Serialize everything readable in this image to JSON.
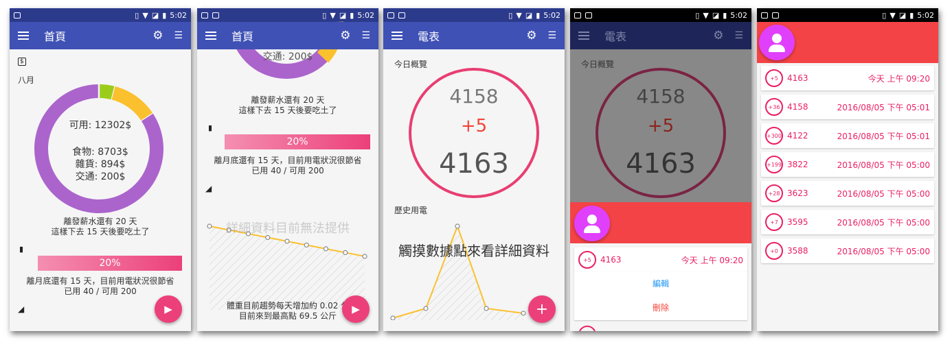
{
  "status": {
    "time": "5:02"
  },
  "colors": {
    "primary": "#3f51b5",
    "accent": "#ec407a",
    "pink": "#e91e63",
    "red": "#f44336"
  },
  "screen1": {
    "title": "首頁",
    "month": "八月",
    "available": "可用: 12302$",
    "cat_food": "食物:  8703$",
    "cat_grocery": "雜貨:    894$",
    "cat_transport": "交通:    200$",
    "payday_line1": "離發薪水還有 20 天",
    "payday_line2": "這樣下去 15 天後要吃土了",
    "progress": "20%",
    "progress_value": 0.2,
    "elec_line1": "離月底還有 15 天，目前用電狀況很節省",
    "elec_line2": "已用 40 / 可用 200"
  },
  "screen2": {
    "title": "首頁",
    "transport_partial": "交通:    200$",
    "payday_line1": "離發薪水還有 20 天",
    "payday_line2": "這樣下去 15 天後要吃土了",
    "progress": "20%",
    "elec_line1": "離月底還有 15 天，目前用電狀況很節省",
    "elec_line2": "已用 40 / 可用 200",
    "chart_overlay": "詳細資料目前無法提供",
    "weight_line1": "體重目前趨勢每天增加約 0.02 公",
    "weight_line2": "目前來到最高點 69.5 公斤"
  },
  "screen3": {
    "title": "電表",
    "overview": "今日概覽",
    "prev_reading": "4158",
    "delta": "+5",
    "current_reading": "4163",
    "history": "歷史用電",
    "touch_hint": "觸摸數據點來看詳細資料"
  },
  "screen4": {
    "title": "電表",
    "overview": "今日概覽",
    "prev_reading": "4158",
    "delta": "+5",
    "current_reading": "4163",
    "row_badge": "+5",
    "row_value": "4163",
    "row_time": "今天 上午 09:20",
    "edit": "編輯",
    "delete": "刪除"
  },
  "screen5": {
    "rows": [
      {
        "badge": "+5",
        "value": "4163",
        "time": "今天 上午 09:20"
      },
      {
        "badge": "+36",
        "value": "4158",
        "time": "2016/08/05 下午 05:01"
      },
      {
        "badge": "+300",
        "value": "4122",
        "time": "2016/08/05 下午 05:01"
      },
      {
        "badge": "+199",
        "value": "3822",
        "time": "2016/08/05 下午 05:00"
      },
      {
        "badge": "+28",
        "value": "3623",
        "time": "2016/08/05 下午 05:00"
      },
      {
        "badge": "+7",
        "value": "3595",
        "time": "2016/08/05 下午 05:00"
      },
      {
        "badge": "+0",
        "value": "3588",
        "time": "2016/08/05 下午 05:00"
      }
    ]
  },
  "chart_data": [
    {
      "type": "pie",
      "categories": [
        "食物",
        "雜貨",
        "交通",
        "可用"
      ],
      "values": [
        8703,
        894,
        200,
        12302
      ],
      "colors": [
        "#ab64cc",
        "#9ccc1a",
        "#fbc02d",
        "#ab64cc"
      ]
    },
    {
      "type": "line",
      "x": [
        1,
        2,
        3,
        4,
        5,
        6,
        7,
        8,
        9
      ],
      "series": [
        {
          "values": [
            69.5,
            69.3,
            69.1,
            68.9,
            68.7,
            68.5,
            68.3,
            68.1,
            67.9
          ]
        }
      ]
    },
    {
      "type": "line",
      "x": [
        1,
        2,
        3,
        4,
        5
      ],
      "series": [
        {
          "values": [
            3588,
            3595,
            4122,
            3623,
            3580
          ]
        }
      ]
    }
  ]
}
